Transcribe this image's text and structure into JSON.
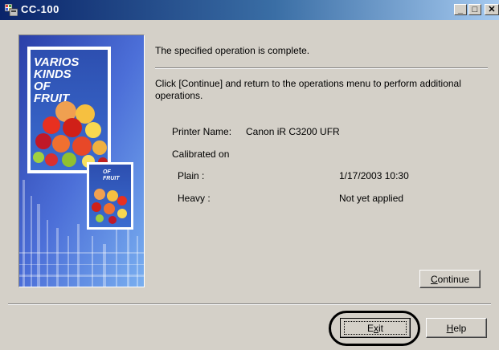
{
  "window": {
    "title": "CC-100",
    "controls": {
      "minimize": "_",
      "maximize": "□",
      "close": "✕"
    }
  },
  "image_panel": {
    "main_text": [
      "VARIOS",
      "KINDS",
      "OF",
      "FRUIT"
    ],
    "small_text": [
      "OF",
      "FRUIT"
    ]
  },
  "message": {
    "status": "The specified operation is complete.",
    "instruction": "Click [Continue] and return to the operations menu to perform additional operations."
  },
  "info": {
    "printer_label": "Printer Name:",
    "printer_value": "Canon iR C3200 UFR",
    "calibrated_label": "Calibrated on",
    "rows": [
      {
        "label": "Plain :",
        "value": "1/17/2003  10:30"
      },
      {
        "label": "Heavy :",
        "value": "Not yet applied"
      }
    ]
  },
  "buttons": {
    "continue": {
      "mnemonic": "C",
      "rest": "ontinue"
    },
    "exit": {
      "pre": "E",
      "mnemonic": "x",
      "rest": "it"
    },
    "help": {
      "mnemonic": "H",
      "rest": "elp"
    }
  },
  "colors": {
    "face": "#d4d0c8",
    "title_start": "#0a246a",
    "title_end": "#a6caf0"
  }
}
